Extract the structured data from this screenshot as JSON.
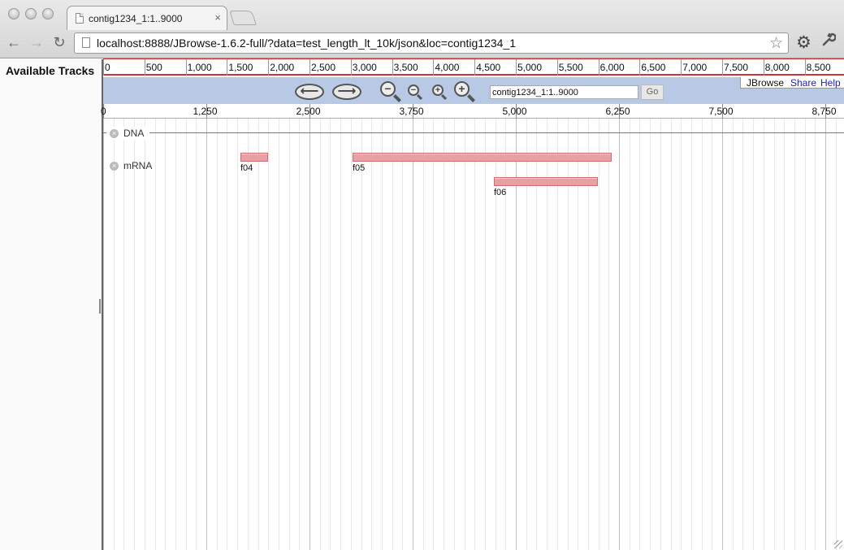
{
  "browser": {
    "tab_title": "contig1234_1:1..9000",
    "tab_close": "×",
    "nav": {
      "back": "←",
      "forward": "→",
      "reload": "↻"
    },
    "url": "localhost:8888/JBrowse-1.6.2-full/?data=test_length_lt_10k/json&loc=contig1234_1",
    "icons": {
      "star": "☆",
      "gear": "⚙",
      "wrench": "🔧"
    }
  },
  "sidebar": {
    "title": "Available Tracks"
  },
  "overview_ruler": {
    "labels": [
      "0",
      "500",
      "1,000",
      "1,500",
      "2,000",
      "2,500",
      "3,000",
      "3,500",
      "4,000",
      "4,500",
      "5,000",
      "5,500",
      "6,000",
      "6,500",
      "7,000",
      "7,500",
      "8,000",
      "8,500"
    ]
  },
  "navbox": {
    "location_value": "contig1234_1:1..9000",
    "go_label": "Go",
    "brand": "JBrowse",
    "links": [
      "Share",
      "Help"
    ],
    "left_arrow": "⟵",
    "right_arrow": "⟶"
  },
  "detail_ruler": {
    "labels": [
      "0",
      "1,250",
      "2,500",
      "3,750",
      "5,000",
      "6,250",
      "7,500",
      "8,750"
    ]
  },
  "tracks": [
    {
      "name": "DNA",
      "close": "×"
    },
    {
      "name": "mRNA",
      "close": "×"
    }
  ],
  "features": [
    {
      "name": "f04",
      "start": 1660,
      "end": 1990
    },
    {
      "name": "f05",
      "start": 3020,
      "end": 6160
    },
    {
      "name": "f06",
      "start": 4730,
      "end": 5990
    }
  ],
  "colors": {
    "navbox": "#b7c9e4",
    "overview_border": "#cc3333",
    "feature_fill": "#e7a1a4",
    "link": "#2020cc"
  }
}
